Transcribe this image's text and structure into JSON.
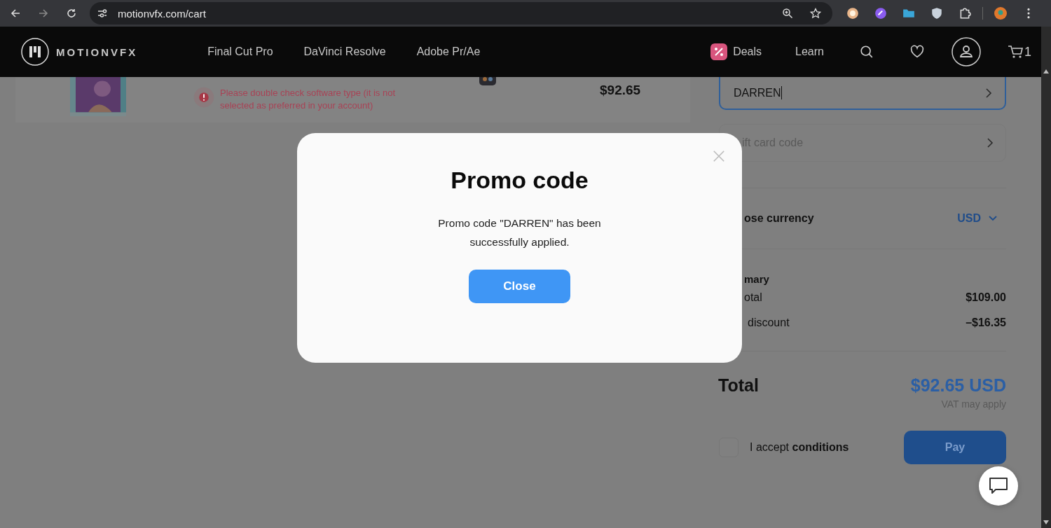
{
  "browser": {
    "url": "motionvfx.com/cart"
  },
  "header": {
    "logo": "MOTIONVFX",
    "nav": [
      "Final Cut Pro",
      "DaVinci Resolve",
      "Adobe Pr/Ae"
    ],
    "deals": "Deals",
    "learn": "Learn",
    "cart_count": "1"
  },
  "cart_item": {
    "warning": "Please double check software type (it is not selected as preferred in your account)",
    "price": "$92.65"
  },
  "promo_field": {
    "value": "DARREN",
    "focused": true
  },
  "gift_card_field": {
    "placeholder": "ift card code"
  },
  "currency": {
    "label": "ose currency",
    "value": "USD"
  },
  "summary": {
    "title": "mary",
    "rows": [
      {
        "label": "otal",
        "value": "$109.00"
      },
      {
        "label": "discount",
        "value": "–$16.35"
      }
    ]
  },
  "total": {
    "label": "Total",
    "value": "$92.65 USD",
    "note": "VAT may apply"
  },
  "accept": {
    "text": "I accept **conditions**",
    "checked": false
  },
  "pay_button": "Pay",
  "modal": {
    "title": "Promo code",
    "message": "Promo code \"DARREN\" has been successfully applied.",
    "button": "Close"
  }
}
